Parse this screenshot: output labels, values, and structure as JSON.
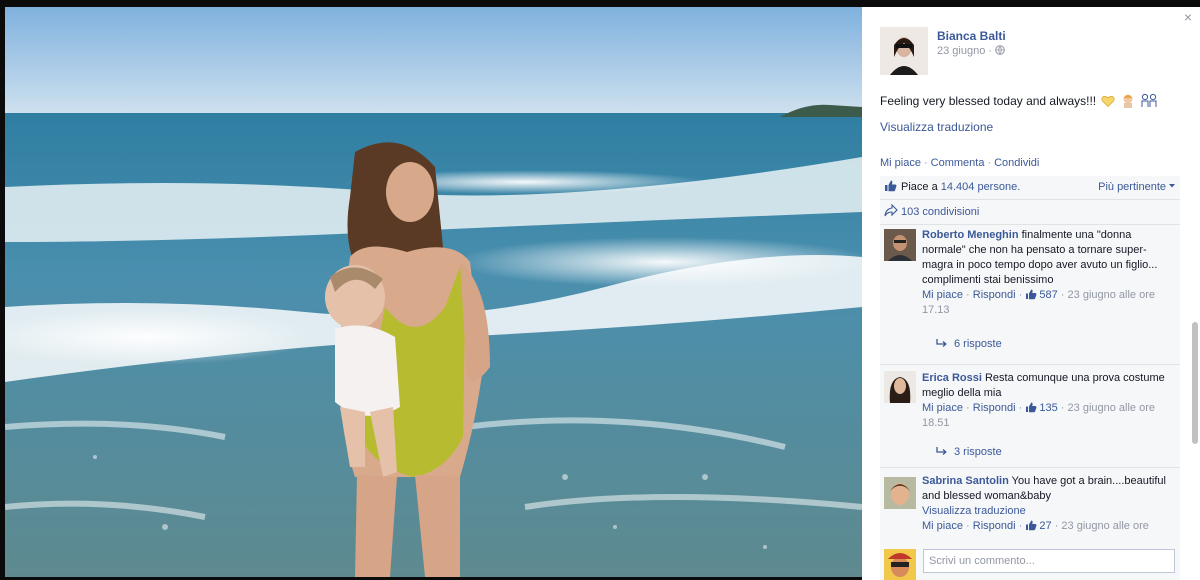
{
  "post": {
    "author": "Bianca Balti",
    "date": "23 giugno",
    "privacy_sep": "·",
    "text": "Feeling very blessed today and always!!!",
    "emojis": [
      "heart-icon",
      "baby-icon",
      "family-icon"
    ],
    "translate": "Visualizza traduzione",
    "actions": {
      "like": "Mi piace",
      "comment": "Commenta",
      "share": "Condividi",
      "sep": "·"
    },
    "likes_prefix": "Piace a ",
    "likes_count": "14.404 persone.",
    "sort_label": "Più pertinente",
    "shares": "103 condivisioni"
  },
  "comments": [
    {
      "name": "Roberto Meneghin",
      "text": "finalmente una \"donna normale\" che non ha pensato a tornare super-magra in poco tempo dopo aver avuto un figlio... complimenti stai benissimo",
      "like": "Mi piace",
      "reply": "Rispondi",
      "likes": "587",
      "time": "23 giugno alle ore 17.13",
      "replies": "6 risposte"
    },
    {
      "name": "Erica Rossi",
      "text": "Resta comunque una prova costume meglio della mia",
      "like": "Mi piace",
      "reply": "Rispondi",
      "likes": "135",
      "time": "23 giugno alle ore 18.51",
      "replies": "3 risposte"
    },
    {
      "name": "Sabrina Santolin",
      "text": "You have got a brain....beautiful and blessed woman&baby",
      "translate": "Visualizza traduzione",
      "like": "Mi piace",
      "reply": "Rispondi",
      "likes": "27",
      "time": "23 giugno alle ore"
    }
  ],
  "composer": {
    "placeholder": "Scrivi un commento..."
  },
  "meta_sep": "·",
  "close": "×",
  "colors": {
    "link": "#3b5998",
    "muted": "#9197a3",
    "ufi_bg": "#f6f7f9"
  }
}
